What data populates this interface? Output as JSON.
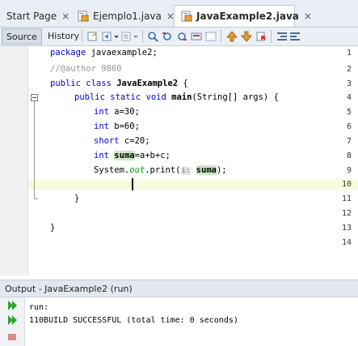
{
  "tabs": [
    {
      "label": "Start Page",
      "close": "×",
      "active": false
    },
    {
      "label": "Ejemplo1.java",
      "close": "×",
      "active": false
    },
    {
      "label": "JavaExample2.java",
      "close": "×",
      "active": true
    }
  ],
  "toolbar": {
    "source": "Source",
    "history": "History"
  },
  "editor": {
    "line_numbers": [
      "1",
      "2",
      "3",
      "4",
      "5",
      "6",
      "7",
      "8",
      "9",
      "10",
      "11",
      "12",
      "13",
      "14"
    ],
    "code": {
      "l1_kw": "package",
      "l1_rest": " javaexample2;",
      "l2": "//@author 9860",
      "l3_kw": "public class",
      "l3_cls": "JavaExample2",
      "l3_rest": " {",
      "l4_kw": "public static void",
      "l4_m": "main",
      "l4_rest": "(String[] args) {",
      "l5_kw": "int",
      "l5_rest": " a=30;",
      "l6_kw": "int",
      "l6_rest": " b=60;",
      "l7_kw": "short",
      "l7_rest": " c=20;",
      "l8_kw": "int",
      "l8_var": "suma",
      "l8_rest": "=a+b+c;",
      "l9_a": "System.",
      "l9_fld": "out",
      "l9_b": ".print(",
      "l9_hint": "i:",
      "l9_var": "suma",
      "l9_c": ");",
      "l11": "}",
      "l13": "}"
    }
  },
  "output": {
    "title": "Output - JavaExample2 (run)",
    "lines": [
      "run:",
      "110BUILD SUCCESSFUL (total time: 0 seconds)"
    ]
  },
  "colors": {
    "keyword": "#0000e6",
    "comment": "#969696",
    "field": "#009900",
    "highlight": "#cde9c8",
    "run": "#2fa12f"
  }
}
